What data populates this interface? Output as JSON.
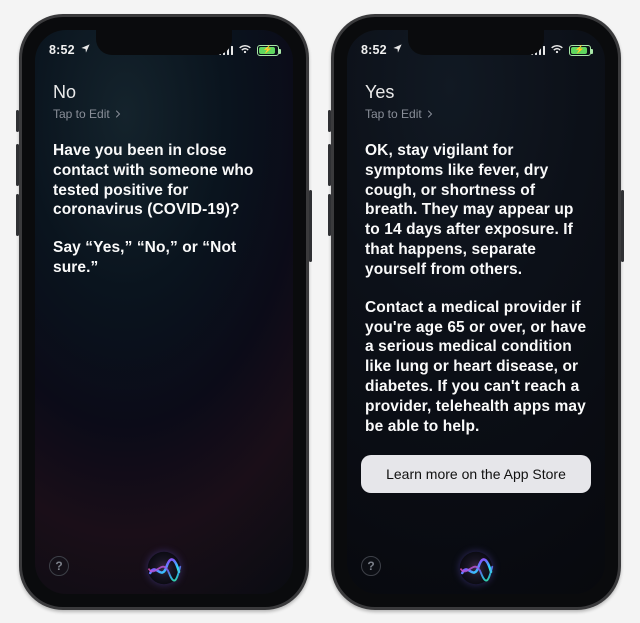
{
  "status": {
    "time": "8:52",
    "location_icon": "location-arrow",
    "signal_bars": 4,
    "wifi": true,
    "battery_charging": true
  },
  "left_screen": {
    "user_text": "No",
    "edit_hint": "Tap to Edit",
    "paragraphs": [
      "Have you been in close contact with someone who tested positive for coronavirus (COVID-19)?",
      "Say “Yes,” “No,” or “Not sure.”"
    ]
  },
  "right_screen": {
    "user_text": "Yes",
    "edit_hint": "Tap to Edit",
    "paragraphs": [
      "OK, stay vigilant for symptoms like fever, dry cough, or shortness of breath. They may appear up to 14 days after exposure. If that happens, separate yourself from others.",
      "Contact a medical provider if you're age 65 or over, or have a serious medical condition like lung or heart disease, or diabetes. If you can't reach a provider, telehealth apps may be able to help."
    ],
    "cta_label": "Learn more on the App Store"
  },
  "help_label": "?",
  "colors": {
    "cta_bg": "#e6e6ea",
    "cta_text": "#111111",
    "text_primary": "#fafafa",
    "text_muted": "#8a8f99",
    "battery_green": "#5fd65f"
  }
}
